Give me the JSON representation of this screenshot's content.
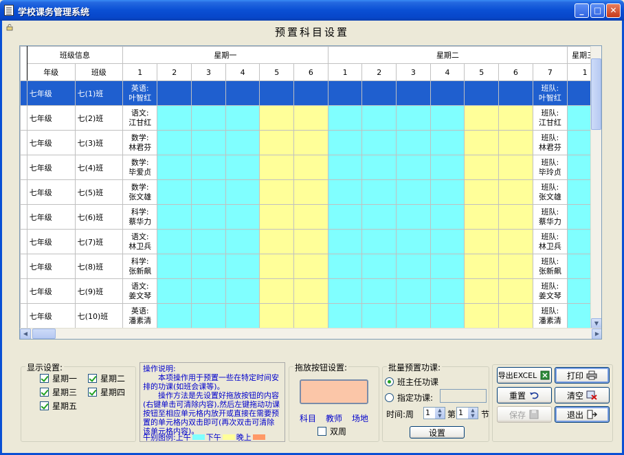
{
  "window": {
    "title": "学校课务管理系统"
  },
  "page_title": "预置科目设置",
  "grid": {
    "group_headers": {
      "class_info": "班级信息",
      "day1": "星期一",
      "day2": "星期二",
      "day3": "星期三"
    },
    "col_headers": {
      "grade": "年级",
      "class": "班级"
    },
    "periods_day1": [
      "1",
      "2",
      "3",
      "4",
      "5",
      "6"
    ],
    "periods_day2": [
      "1",
      "2",
      "3",
      "4",
      "5",
      "6",
      "7"
    ],
    "period_day3_first": "1",
    "rows": [
      {
        "grade": "七年级",
        "class": "七(1)班",
        "d1p1": "英语:",
        "d1p1b": "叶智红",
        "d2p7": "班队:",
        "d2p7b": "叶智红"
      },
      {
        "grade": "七年级",
        "class": "七(2)班",
        "d1p1": "语文:",
        "d1p1b": "江甘红",
        "d2p7": "班队:",
        "d2p7b": "江甘红"
      },
      {
        "grade": "七年级",
        "class": "七(3)班",
        "d1p1": "数学:",
        "d1p1b": "林君芬",
        "d2p7": "班队:",
        "d2p7b": "林君芬"
      },
      {
        "grade": "七年级",
        "class": "七(4)班",
        "d1p1": "数学:",
        "d1p1b": "毕爱贞",
        "d2p7": "班队:",
        "d2p7b": "毕玲贞"
      },
      {
        "grade": "七年级",
        "class": "七(5)班",
        "d1p1": "数学:",
        "d1p1b": "张文雄",
        "d2p7": "班队:",
        "d2p7b": "张文雄"
      },
      {
        "grade": "七年级",
        "class": "七(6)班",
        "d1p1": "科学:",
        "d1p1b": "蔡华力",
        "d2p7": "班队:",
        "d2p7b": "蔡华力"
      },
      {
        "grade": "七年级",
        "class": "七(7)班",
        "d1p1": "语文:",
        "d1p1b": "林卫兵",
        "d2p7": "班队:",
        "d2p7b": "林卫兵"
      },
      {
        "grade": "七年级",
        "class": "七(8)班",
        "d1p1": "科学:",
        "d1p1b": "张新飙",
        "d2p7": "班队:",
        "d2p7b": "张新飙"
      },
      {
        "grade": "七年级",
        "class": "七(9)班",
        "d1p1": "语文:",
        "d1p1b": "姜文琴",
        "d2p7": "班队:",
        "d2p7b": "姜文琴"
      },
      {
        "grade": "七年级",
        "class": "七(10)班",
        "d1p1": "英语:",
        "d1p1b": "潘素清",
        "d2p7": "班队:",
        "d2p7b": "潘素清"
      }
    ]
  },
  "display_settings": {
    "title": "显示设置:",
    "days": [
      {
        "label": "星期一",
        "checked": true
      },
      {
        "label": "星期二",
        "checked": true
      },
      {
        "label": "星期三",
        "checked": true
      },
      {
        "label": "星期四",
        "checked": true
      },
      {
        "label": "星期五",
        "checked": true
      }
    ]
  },
  "instructions": {
    "head": "操作说明:",
    "p1": "本项操作用于预置一些在特定时间安排的功课(如班会课等)。",
    "p2": "操作方法是先设置好拖放按钮的内容(右键单击可清除内容),然后左键拖动功课按钮至相应单元格内放开或直接在需要预置的单元格内双击即可(再次双击可清除该单元格内容)。",
    "legend_label": "午别图例:",
    "am": "上午",
    "pm": "下午",
    "eve": "晚上",
    "colors": {
      "am": "#80ffff",
      "pm": "#ffff99",
      "eve": "#ff9966"
    }
  },
  "drag_settings": {
    "title": "拖放按钮设置:",
    "subject": "科目",
    "teacher": "教师",
    "venue": "场地",
    "double_week": "双周"
  },
  "batch": {
    "title": "批量预置功课:",
    "opt1": "班主任功课",
    "opt2": "指定功课:",
    "time_label": "时间:周",
    "week_value": "1",
    "period_prefix": "第",
    "period_value": "1",
    "period_suffix": "节",
    "set_button": "设置"
  },
  "actions": {
    "export": "导出EXCEL",
    "print": "打印",
    "reset": "重置",
    "clear": "清空",
    "save": "保存",
    "exit": "退出"
  }
}
